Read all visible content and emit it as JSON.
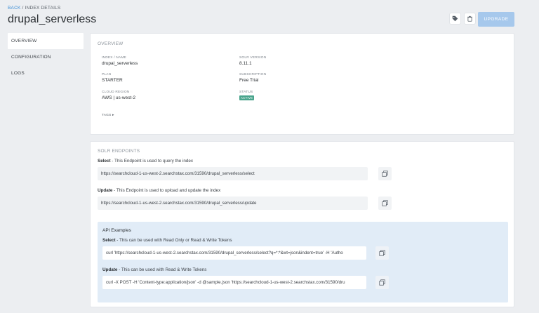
{
  "breadcrumb": {
    "back": "BACK",
    "separator": " / ",
    "current": "INDEX DETAILS"
  },
  "page_title": "drupal_serverless",
  "header": {
    "upgrade_label": "UPGRADE",
    "tag_icon": "tag-icon",
    "trash_icon": "trash-icon"
  },
  "sidebar": {
    "items": [
      {
        "label": "OVERVIEW",
        "active": true
      },
      {
        "label": "CONFIGURATION",
        "active": false
      },
      {
        "label": "LOGS",
        "active": false
      }
    ]
  },
  "overview": {
    "title": "OVERVIEW",
    "index_name_label": "INDEX / NAME",
    "index_name": "drupal_serverless",
    "solr_version_label": "SOLR VERSION",
    "solr_version": "8.11.1",
    "plan_label": "PLAN",
    "plan": "STARTER",
    "subscription_label": "SUBSCRIPTION",
    "subscription": "Free Trial",
    "region_label": "CLOUD REGION",
    "region": "AWS | us-west-2",
    "status_label": "STATUS",
    "status": "ACTIVE",
    "status_color": "#4aa58d",
    "tags_label": "TAGS ▸"
  },
  "endpoints": {
    "title": "SOLR ENDPOINTS",
    "select": {
      "name": "Select",
      "desc": " - This Endpoint is used to query the index",
      "url": "https://searchcloud-1-us-west-2.searchstax.com/31590/drupal_serverless/select"
    },
    "update": {
      "name": "Update",
      "desc": " - This Endpoint is used to upload and update the index",
      "url": "https://searchcloud-1-us-west-2.searchstax.com/31590/drupal_serverless/update"
    },
    "api": {
      "title": "API Examples",
      "select": {
        "name": "Select",
        "desc": " - This can be used with Read Only or Read & Write Tokens",
        "cmd": "curl 'https://searchcloud-1-us-west-2.searchstax.com/31590/drupal_serverless/select?q=*:*&wt=json&indent=true' -H 'Autho"
      },
      "update": {
        "name": "Update",
        "desc": " - This can be used with Read & Write Tokens",
        "cmd": "curl -X POST -H 'Content-type:application/json' -d @sample.json 'https://searchcloud-1-us-west-2.searchstax.com/31590/dru"
      }
    }
  },
  "colors": {
    "accent": "#3d8fd6",
    "upgrade_bg": "#a6c8ec",
    "api_panel_bg": "#e1ecf7"
  }
}
